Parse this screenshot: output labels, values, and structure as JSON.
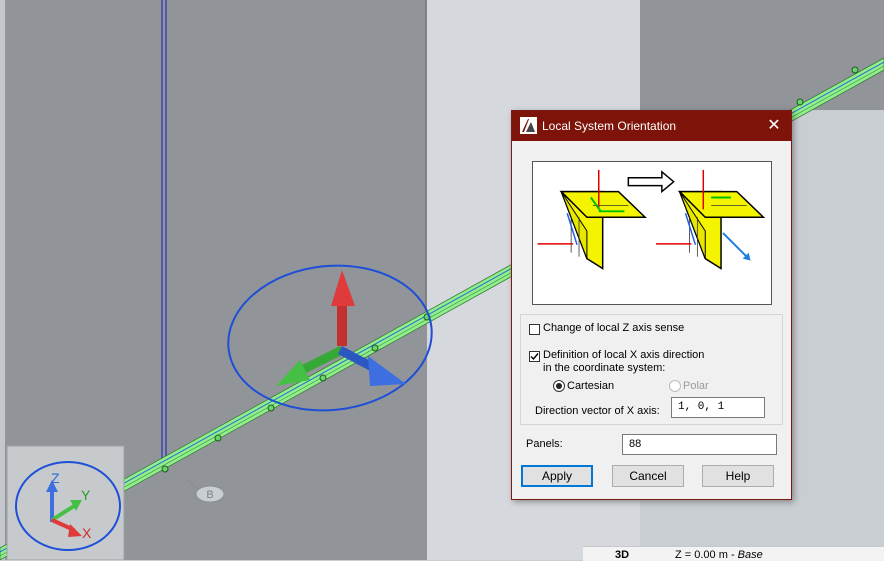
{
  "dialog": {
    "title": "Local System Orientation",
    "close_glyph": "✕",
    "illustration_icons": [
      "z-axis-sense-before-icon",
      "z-axis-sense-after-icon",
      "arrow-right-icon"
    ],
    "change_z_sense": {
      "label": "Change of local Z axis sense",
      "checked": false
    },
    "define_x_axis": {
      "label_line1": "Definition of local X axis direction",
      "label_line2": "in the coordinate system:",
      "checked": true
    },
    "coord_system": {
      "cartesian_label": "Cartesian",
      "polar_label": "Polar",
      "selected": "Cartesian"
    },
    "direction_vector": {
      "label": "Direction vector of X axis:",
      "value": "1, 0, 1"
    },
    "panels": {
      "label": "Panels:",
      "value": "88"
    },
    "buttons": {
      "apply": "Apply",
      "cancel": "Cancel",
      "help": "Help"
    }
  },
  "viewport": {
    "grid_label": "B",
    "axis_labels": {
      "z": "Z",
      "y": "Y",
      "x": "X"
    },
    "colors": {
      "beam": "#8ef08a",
      "x_axis": "#e03b3b",
      "y_axis": "#3bbf3b",
      "z_axis": "#2f68d8",
      "annotation": "#1f4fd6",
      "title_bar": "#7d1309"
    }
  },
  "statusbar": {
    "view": "3D",
    "level_prefix": "Z = 0.00 m - ",
    "level_name": "Base"
  }
}
